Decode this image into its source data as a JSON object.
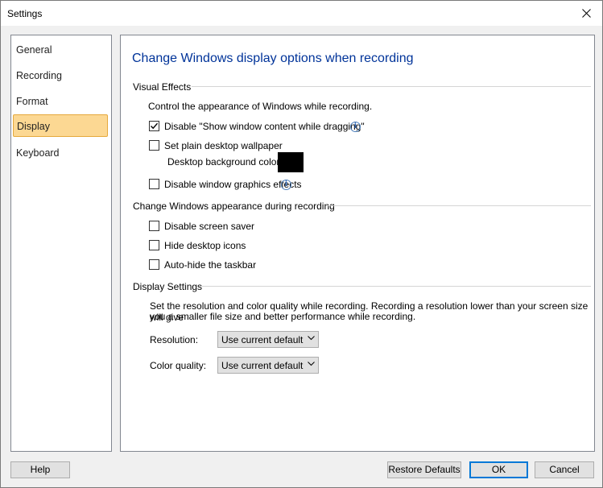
{
  "window": {
    "title": "Settings"
  },
  "sidebar": {
    "items": [
      {
        "label": "General",
        "active": false
      },
      {
        "label": "Recording",
        "active": false
      },
      {
        "label": "Format",
        "active": false
      },
      {
        "label": "Display",
        "active": true
      },
      {
        "label": "Keyboard",
        "active": false
      }
    ]
  },
  "panel": {
    "title": "Change Windows display options when recording",
    "visual_effects": {
      "heading": "Visual Effects",
      "description": "Control the appearance of Windows while recording.",
      "disable_drag_content": {
        "label": "Disable \"Show window content while dragging\"",
        "checked": true
      },
      "plain_wallpaper": {
        "label": "Set plain desktop wallpaper",
        "checked": false
      },
      "bg_color_label": "Desktop background color:",
      "bg_color": "#000000",
      "disable_graphics": {
        "label": "Disable window graphics effects",
        "checked": false
      }
    },
    "appearance": {
      "heading": "Change Windows appearance during recording",
      "screen_saver": {
        "label": "Disable screen saver",
        "checked": false
      },
      "hide_icons": {
        "label": "Hide desktop icons",
        "checked": false
      },
      "autohide_taskbar": {
        "label": "Auto-hide the taskbar",
        "checked": false
      }
    },
    "display_settings": {
      "heading": "Display Settings",
      "description_line1": "Set the resolution and color quality while recording. Recording a resolution lower than your screen size will give",
      "description_line2": "you a smaller file size and better performance while recording.",
      "resolution_label": "Resolution:",
      "resolution_value": "Use current default",
      "color_quality_label": "Color quality:",
      "color_quality_value": "Use current default"
    }
  },
  "buttons": {
    "help": "Help",
    "restore": "Restore Defaults",
    "ok": "OK",
    "cancel": "Cancel"
  }
}
